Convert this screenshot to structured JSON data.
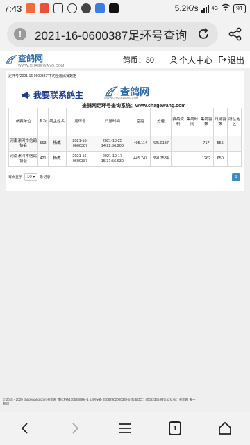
{
  "status_bar": {
    "time": "7:43",
    "net_speed": "5.2K/s",
    "network": "4G",
    "battery": "91"
  },
  "address_bar": {
    "url_text": "2021-16-0600387足环号查询"
  },
  "site_header": {
    "logo_text": "查鸽网",
    "logo_sub": "WWW.CHAGEWANG.COM",
    "coins_label": "鸽币：30",
    "user_center": "个人中心",
    "logout": "退出"
  },
  "card": {
    "caption": "足环号\"2021-16-0600387\"下的全部比赛数据",
    "contact_banner": "我要联系鸽主",
    "logo_text": "查鸽网",
    "logo_sub": "WWW.CHAGEWANG.COM",
    "system_line": "查鸽网足环号查询系统：www.chagewang.com"
  },
  "table": {
    "headers": [
      "参赛单位",
      "名次",
      "鸽主姓名",
      "足环号",
      "归巢时间",
      "空距",
      "分速",
      "赛鸽资料",
      "集鸽时间",
      "集鸽羽数",
      "归巢羽数",
      "所在地区"
    ],
    "rows": [
      [
        "河南漯河市信鸽协会",
        "553",
        "杨威",
        "2021-16-0600387",
        "2021-10-25 14:22:56.200",
        "495.114",
        "425.0137",
        "",
        "",
        "717",
        "555",
        ""
      ],
      [
        "河南漯河市信鸽协会",
        "421",
        "杨威",
        "2021-16-0600387",
        "2021-10-17 15:31:56.630",
        "445.747",
        "850.7534",
        "",
        "",
        "1262",
        "650",
        ""
      ]
    ]
  },
  "pagination": {
    "prefix": "每页显示",
    "page_size": "10",
    "suffix": "条记录",
    "current_page": "1"
  },
  "footer": {
    "line1": "© 2015 - 2020 chagewang.com 查鸽网 豫ICP备17053689号-1   公网安备 37082902000339号   客服QQ：40052365   微信公众号：查鸽网   关于",
    "line2": "我们"
  },
  "nav_bar": {
    "tab_count": "1"
  },
  "colors": {
    "brand_blue": "#2b6aa9",
    "banner_blue": "#1c3d8f",
    "page_button": "#3c8dbc"
  }
}
